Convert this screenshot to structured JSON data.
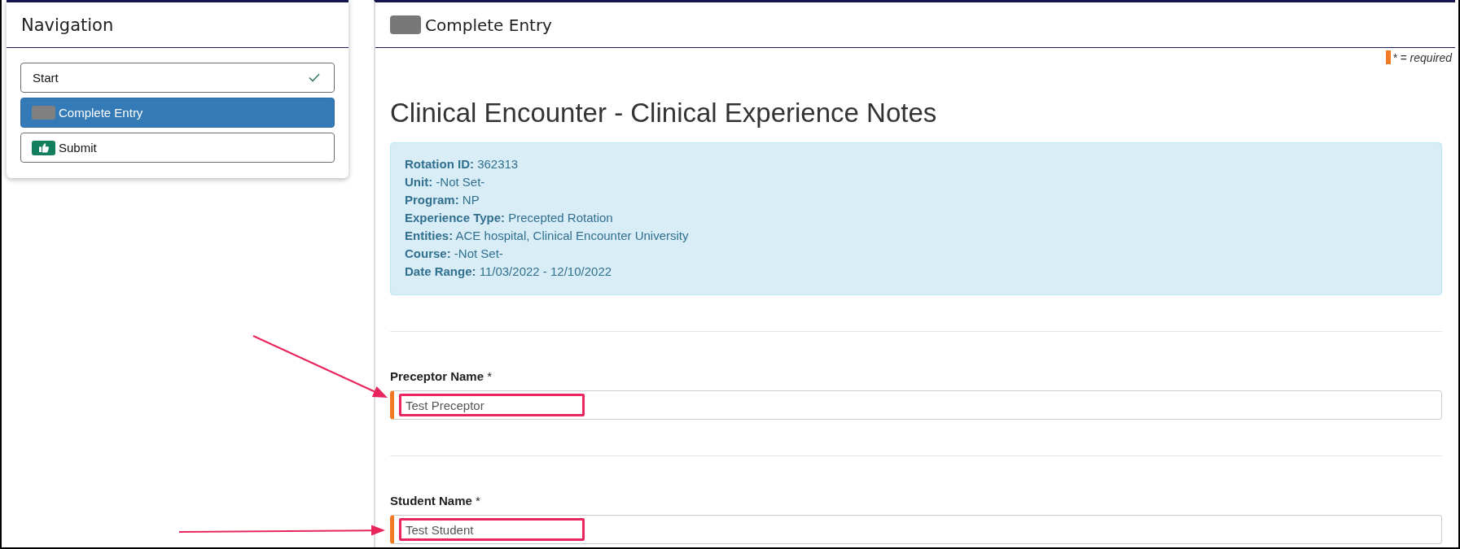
{
  "navigation": {
    "title": "Navigation",
    "items": [
      {
        "label": "Start",
        "kind": "plain",
        "selected": false,
        "completed": true
      },
      {
        "label": "Complete Entry",
        "kind": "tile",
        "selected": true,
        "completed": false
      },
      {
        "label": "Submit",
        "kind": "badge",
        "selected": false,
        "completed": false
      }
    ]
  },
  "header": {
    "title": "Complete Entry"
  },
  "required_legend": {
    "text": "* = required"
  },
  "page_title": "Clinical Encounter - Clinical Experience Notes",
  "info_box": {
    "lines": [
      "**Rotation ID:** 362313",
      "**Unit:** -Not Set-",
      "**Program:** NP",
      "**Experience Type:** Precepted Rotation",
      "**Entities:** ACE hospital, Clinical Encounter University",
      "**Course:** -Not Set-",
      "**Date Range:** 11/03/2022 - 12/10/2022"
    ]
  },
  "fields": [
    {
      "kind": "diagonal-arrow",
      "label": "Preceptor Name",
      "required_mark": "*",
      "required": true,
      "value": "Test Preceptor",
      "highlighted": true
    },
    {
      "kind": "straight-arrow",
      "label": "Student Name",
      "required_mark": "*",
      "required": true,
      "value": "Test Student",
      "highlighted": true
    }
  ]
}
